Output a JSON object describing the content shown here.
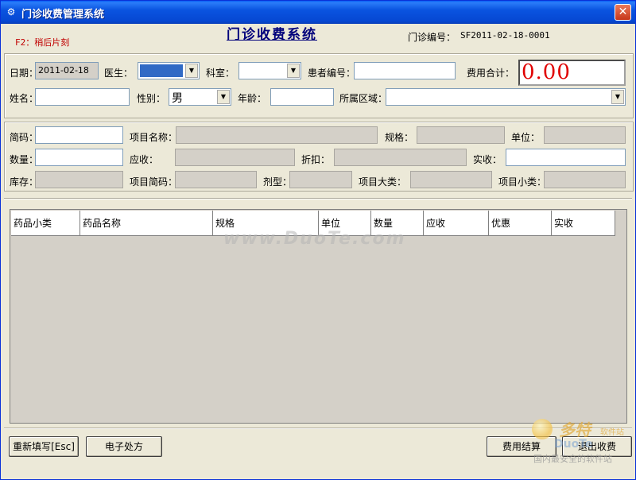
{
  "window": {
    "title": "门诊收费管理系统",
    "app_icon": "app-icon"
  },
  "header": {
    "hint": "F2：稍后片刻",
    "system_title": "门诊收费系统",
    "clinic_no_label": "门诊编号：",
    "clinic_no_value": "SF2011-02-18-0001"
  },
  "patient": {
    "date_label": "日期：",
    "date_value": "2011-02-18",
    "doctor_label": "医生：",
    "doctor_value": "",
    "dept_label": "科室：",
    "dept_value": "",
    "patient_no_label": "患者编号：",
    "patient_no_value": "",
    "total_label": "费用合计：",
    "total_value": "0.00",
    "name_label": "姓名：",
    "name_value": "",
    "gender_label": "性别：",
    "gender_value": "男",
    "age_label": "年龄：",
    "age_value": "",
    "region_label": "所属区域：",
    "region_value": ""
  },
  "item": {
    "code_label": "简码：",
    "item_name_label": "项目名称：",
    "spec_label": "规格：",
    "unit_label": "单位：",
    "qty_label": "数量：",
    "receivable_label": "应收：",
    "discount_label": "折扣：",
    "actual_label": "实收：",
    "stock_label": "库存：",
    "item_code_label": "项目简码：",
    "dosage_label": "剂型：",
    "major_cat_label": "项目大类：",
    "minor_cat_label": "项目小类："
  },
  "table": {
    "columns": [
      "药品小类",
      "药品名称",
      "规格",
      "单位",
      "数量",
      "应收",
      "优惠",
      "实收"
    ]
  },
  "buttons": {
    "reset": "重新填写[Esc]",
    "e_prescription": "电子处方",
    "settle": "费用结算",
    "exit": "退出收费"
  },
  "watermark": {
    "center": "www.DuoTe.com",
    "logo_main": "多特",
    "logo_sub": "软件站",
    "logo_domain": "DuoTe",
    "logo_tag": "国内最安全的软件站"
  }
}
